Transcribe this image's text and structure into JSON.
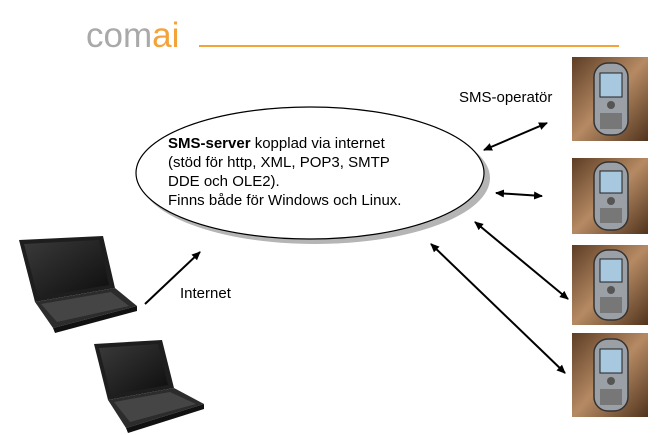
{
  "logo": {
    "prefix": "com",
    "accent": "ai",
    "accent_color": "#f2a33a",
    "text_color": "#a9a9a9"
  },
  "server": {
    "title_bold": "SMS-server",
    "title_rest": " kopplad via internet",
    "lines": [
      "(stöd för http, XML, POP3, SMTP",
      "DDE och OLE2).",
      "Finns både för Windows och Linux."
    ]
  },
  "labels": {
    "operator": "SMS-operatör",
    "internet": "Internet"
  },
  "devices": {
    "laptops": [
      "laptop-1",
      "laptop-2"
    ],
    "phones": [
      "phone-1",
      "phone-2",
      "phone-3",
      "phone-4"
    ]
  }
}
